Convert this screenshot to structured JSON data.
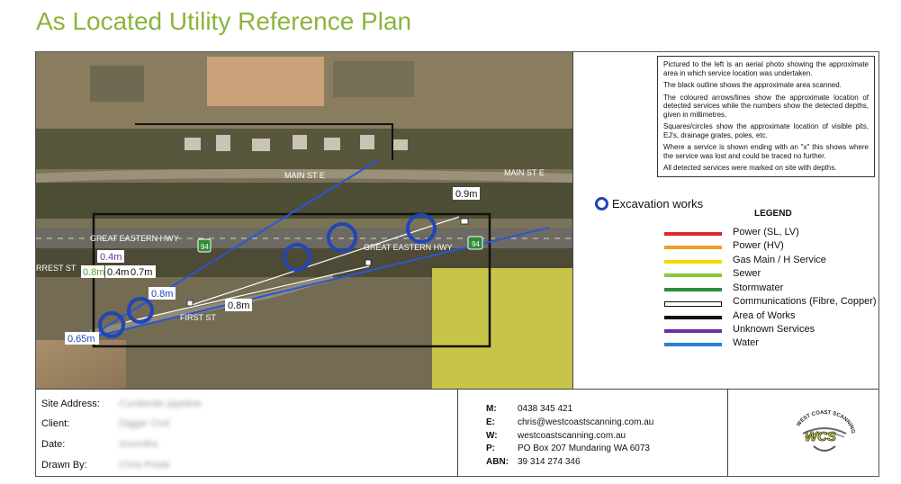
{
  "title": "As Located Utility Reference Plan",
  "notes": [
    "Pictured to the left is an aerial photo showing the approximate area in which service location was undertaken.",
    "The black outline shows the approximate area scanned.",
    "The coloured arrows/lines show the approximate location of detected services while the numbers show the detected depths, given in millimetres.",
    "Squares/circles show the approximate location of visible pits, EJ's, drainage grates, poles, etc.",
    "Where a service is shown ending with an \"x\" this shows where the service was lost and could be traced no further.",
    "All detected services were marked on site with depths."
  ],
  "excavation_label": "Excavation works",
  "legend": {
    "title": "LEGEND",
    "items": [
      {
        "label": "Power (SL, LV)",
        "color": "#e0262b"
      },
      {
        "label": "Power (HV)",
        "color": "#f0a020"
      },
      {
        "label": "Gas Main / H Service",
        "color": "#f5d800"
      },
      {
        "label": "Sewer",
        "color": "#8cc63f"
      },
      {
        "label": "Stormwater",
        "color": "#2e8b3a"
      },
      {
        "label": "Communications (Fibre, Copper)",
        "color": "#ffffff"
      },
      {
        "label": "Area of Works",
        "color": "#111111"
      },
      {
        "label": "Unknown Services",
        "color": "#6a2fa0"
      },
      {
        "label": "Water",
        "color": "#2a80d0"
      }
    ]
  },
  "map": {
    "streets": {
      "main_st_1": "MAIN ST E",
      "main_st_2": "MAIN ST E",
      "great_eastern_1": "GREAT EASTERN HWY",
      "great_eastern_2": "GREAT EASTERN HWY",
      "first_st": "FIRST ST",
      "forrest_st": "RREST ST",
      "route_shield": "94"
    },
    "depths": {
      "d_09": "0.9m",
      "d_04_purple": "0.4m",
      "d_08_green": "0.8m",
      "d_04": "0.4m",
      "d_07": "0.7m",
      "d_08_blue": "0.8m",
      "d_08": "0.8m",
      "d_065": "0.65m"
    }
  },
  "site": {
    "address_label": "Site Address:",
    "address_value": "Cunderdin pipeline",
    "client_label": "Client:",
    "client_value": "Digger Civil",
    "date_label": "Date:",
    "date_value": "Xmonths",
    "drawn_label": "Drawn By:",
    "drawn_value": "Chris Poole"
  },
  "contact": {
    "m_label": "M:",
    "m_value": "0438 345 421",
    "e_label": "E:",
    "e_value": "chris@westcoastscanning.com.au",
    "w_label": "W:",
    "w_value": "westcoastscanning.com.au",
    "p_label": "P:",
    "p_value": "PO  Box  207 Mundaring WA 6073",
    "abn_label": "ABN:",
    "abn_value": "39 314 274 346"
  },
  "logo": {
    "text": "WCS",
    "arc_text": "WEST COAST SCANNING"
  }
}
